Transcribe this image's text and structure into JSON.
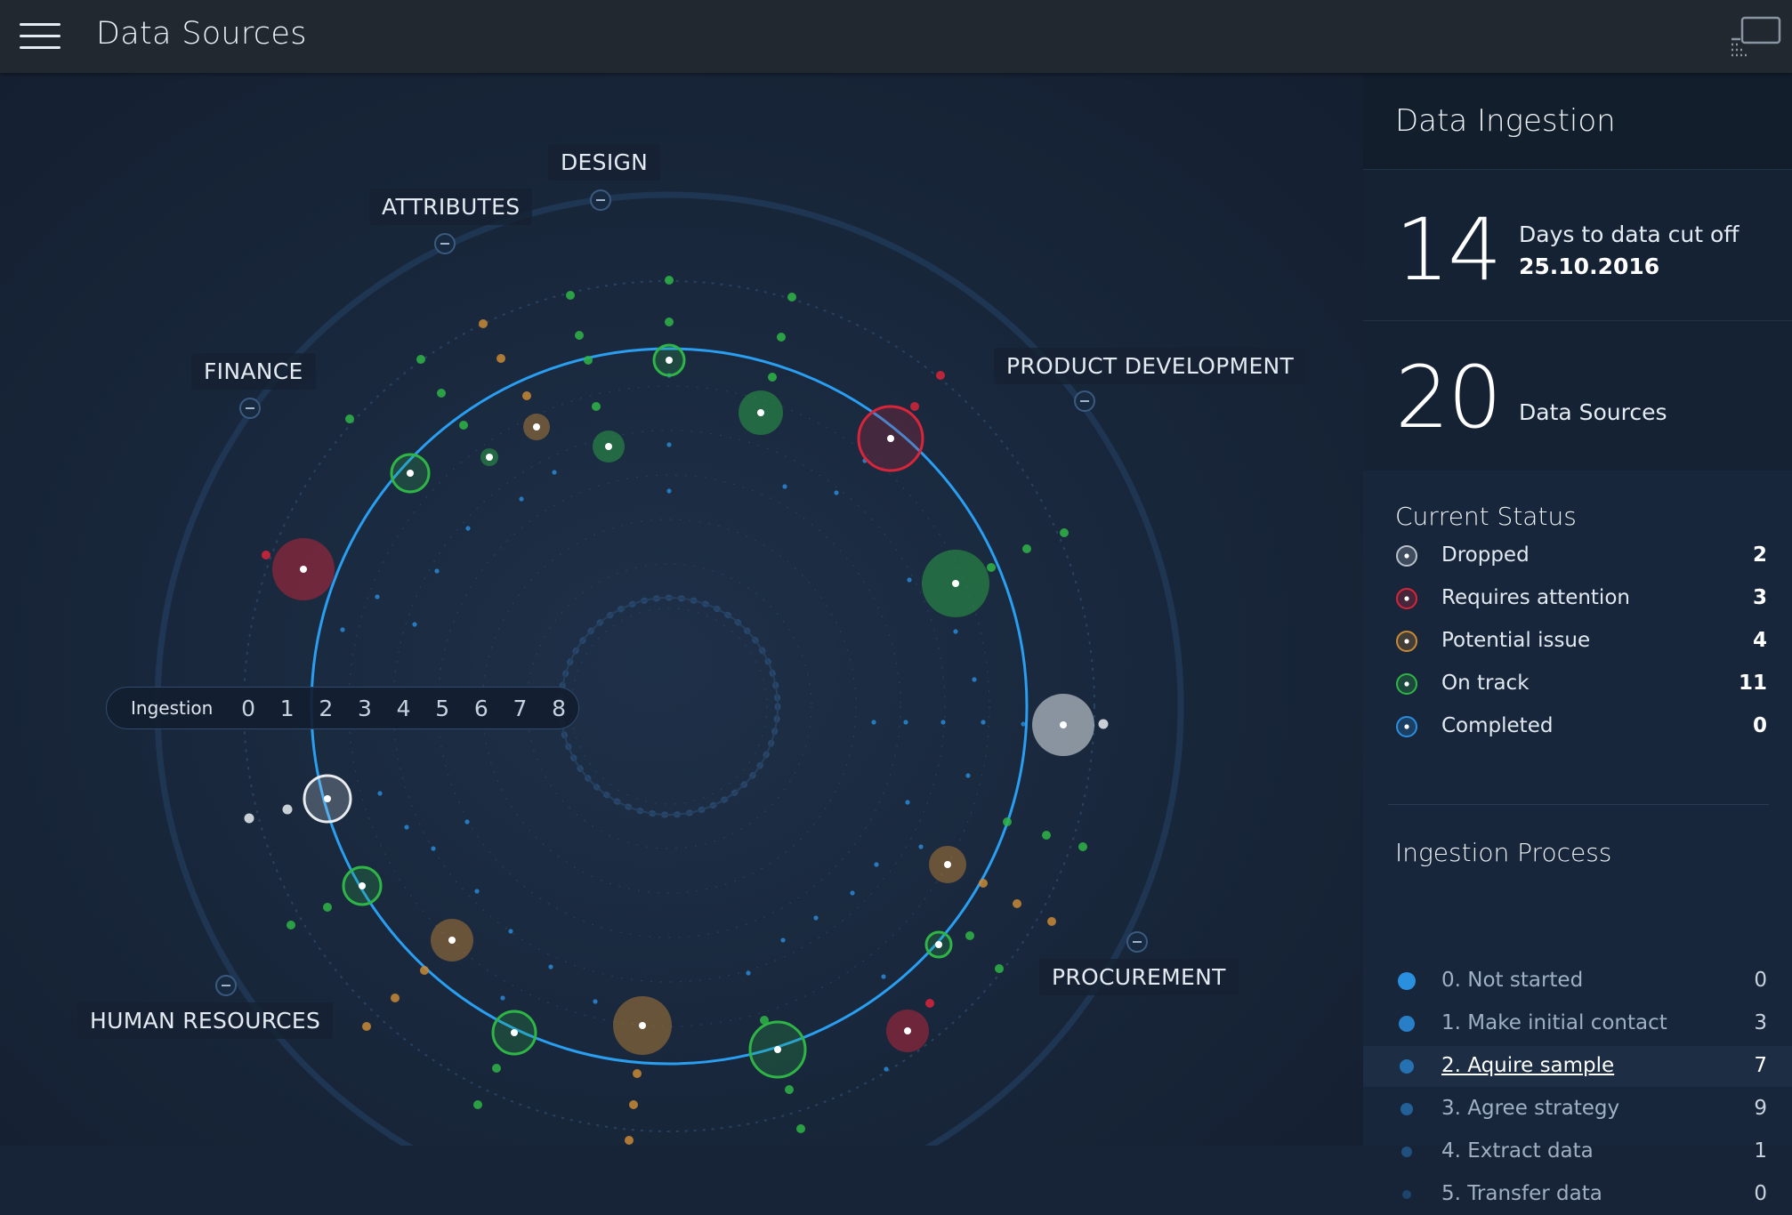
{
  "app": {
    "title": "Data Sources"
  },
  "departments": [
    {
      "key": "design",
      "label": "DESIGN"
    },
    {
      "key": "attributes",
      "label": "ATTRIBUTES"
    },
    {
      "key": "finance",
      "label": "FINANCE"
    },
    {
      "key": "product-development",
      "label": "PRODUCT DEVELOPMENT"
    },
    {
      "key": "human-resources",
      "label": "HUMAN RESOURCES"
    },
    {
      "key": "procurement",
      "label": "PROCUREMENT"
    }
  ],
  "ingestion_scale": {
    "label": "Ingestion",
    "steps": [
      "0",
      "1",
      "2",
      "3",
      "4",
      "5",
      "6",
      "7",
      "8"
    ]
  },
  "panel": {
    "title": "Data Ingestion",
    "days": {
      "value": "14",
      "label": "Days to data cut off",
      "date": "25.10.2016"
    },
    "sources": {
      "value": "20",
      "label": "Data Sources"
    },
    "status": {
      "title": "Current Status",
      "items": [
        {
          "label": "Dropped",
          "count": "2",
          "color": "#b9c1cc"
        },
        {
          "label": "Requires attention",
          "count": "3",
          "color": "#d8253a"
        },
        {
          "label": "Potential issue",
          "count": "4",
          "color": "#c98a35"
        },
        {
          "label": "On track",
          "count": "11",
          "color": "#2fb546"
        },
        {
          "label": "Completed",
          "count": "0",
          "color": "#2b8fe0"
        }
      ]
    },
    "process": {
      "title": "Ingestion Process",
      "items": [
        {
          "label": "0. Not started",
          "count": "0"
        },
        {
          "label": "1. Make initial contact",
          "count": "3"
        },
        {
          "label": "2. Aquire sample",
          "count": "7"
        },
        {
          "label": "3. Agree strategy",
          "count": "9"
        },
        {
          "label": "4. Extract data",
          "count": "1"
        },
        {
          "label": "5. Transfer data",
          "count": "0"
        }
      ]
    }
  },
  "colors": {
    "topbar": "#212830",
    "accent_ring": "#2a9ef0",
    "dropped": "#b9c1cc",
    "attention": "#d8253a",
    "issue": "#c98a35",
    "on_track": "#2fb546",
    "completed": "#2b8fe0"
  },
  "icons": {
    "menu": "hamburger-menu-icon",
    "cast": "cast-screen-icon",
    "collapse": "minus-circle-icon"
  }
}
